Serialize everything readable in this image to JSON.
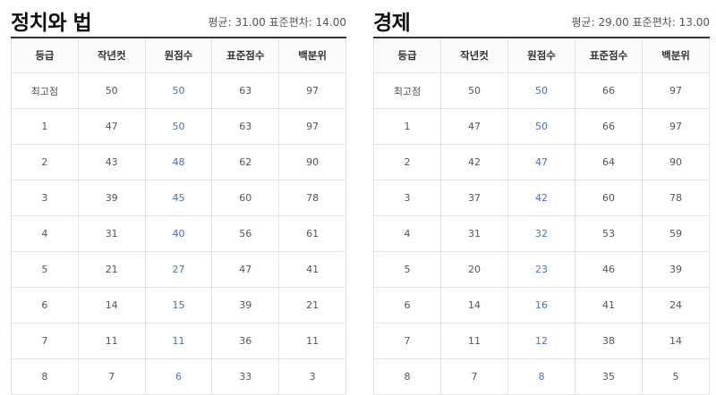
{
  "headers": [
    "등급",
    "작년컷",
    "원점수",
    "표준점수",
    "백분위"
  ],
  "tables": [
    {
      "title": "정치와 법",
      "stats": "평균: 31.00 표준편차: 14.00",
      "rows": [
        [
          "최고점",
          "50",
          "50",
          "63",
          "97"
        ],
        [
          "1",
          "47",
          "50",
          "63",
          "97"
        ],
        [
          "2",
          "43",
          "48",
          "62",
          "90"
        ],
        [
          "3",
          "39",
          "45",
          "60",
          "78"
        ],
        [
          "4",
          "31",
          "40",
          "56",
          "61"
        ],
        [
          "5",
          "21",
          "27",
          "47",
          "41"
        ],
        [
          "6",
          "14",
          "15",
          "39",
          "21"
        ],
        [
          "7",
          "11",
          "11",
          "36",
          "11"
        ],
        [
          "8",
          "7",
          "6",
          "33",
          "3"
        ]
      ]
    },
    {
      "title": "경제",
      "stats": "평균: 29.00 표준편차: 13.00",
      "rows": [
        [
          "최고점",
          "50",
          "50",
          "66",
          "97"
        ],
        [
          "1",
          "47",
          "50",
          "66",
          "97"
        ],
        [
          "2",
          "42",
          "47",
          "64",
          "90"
        ],
        [
          "3",
          "37",
          "42",
          "60",
          "78"
        ],
        [
          "4",
          "31",
          "32",
          "53",
          "59"
        ],
        [
          "5",
          "20",
          "23",
          "46",
          "39"
        ],
        [
          "6",
          "14",
          "16",
          "41",
          "24"
        ],
        [
          "7",
          "11",
          "12",
          "38",
          "14"
        ],
        [
          "8",
          "7",
          "8",
          "35",
          "5"
        ]
      ]
    }
  ]
}
